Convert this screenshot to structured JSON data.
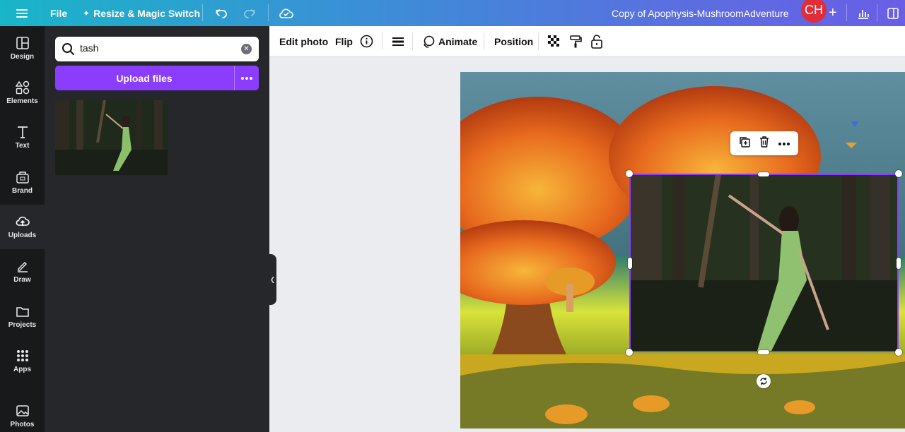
{
  "topbar": {
    "menu_icon": "hamburger-icon",
    "file_label": "File",
    "resize_label": "Resize & Magic Switch",
    "doc_title": "Copy of Apophysis-MushroomAdventure",
    "avatar_initials": "CH",
    "gradient_start": "#19b5c9",
    "gradient_end": "#6a5ee6"
  },
  "rail": {
    "items": [
      {
        "label": "Design",
        "icon": "design-icon"
      },
      {
        "label": "Elements",
        "icon": "elements-icon"
      },
      {
        "label": "Text",
        "icon": "text-icon"
      },
      {
        "label": "Brand",
        "icon": "brand-icon"
      },
      {
        "label": "Uploads",
        "icon": "upload-cloud-icon",
        "active": true
      },
      {
        "label": "Draw",
        "icon": "pen-icon"
      },
      {
        "label": "Projects",
        "icon": "folder-icon"
      },
      {
        "label": "Apps",
        "icon": "grid-icon"
      },
      {
        "label": "Photos",
        "icon": "photo-icon"
      }
    ]
  },
  "panel": {
    "search_value": "tash",
    "upload_label": "Upload files",
    "accent": "#8b3dff"
  },
  "toolbar": {
    "edit_photo": "Edit photo",
    "flip": "Flip",
    "animate": "Animate",
    "position": "Position"
  }
}
